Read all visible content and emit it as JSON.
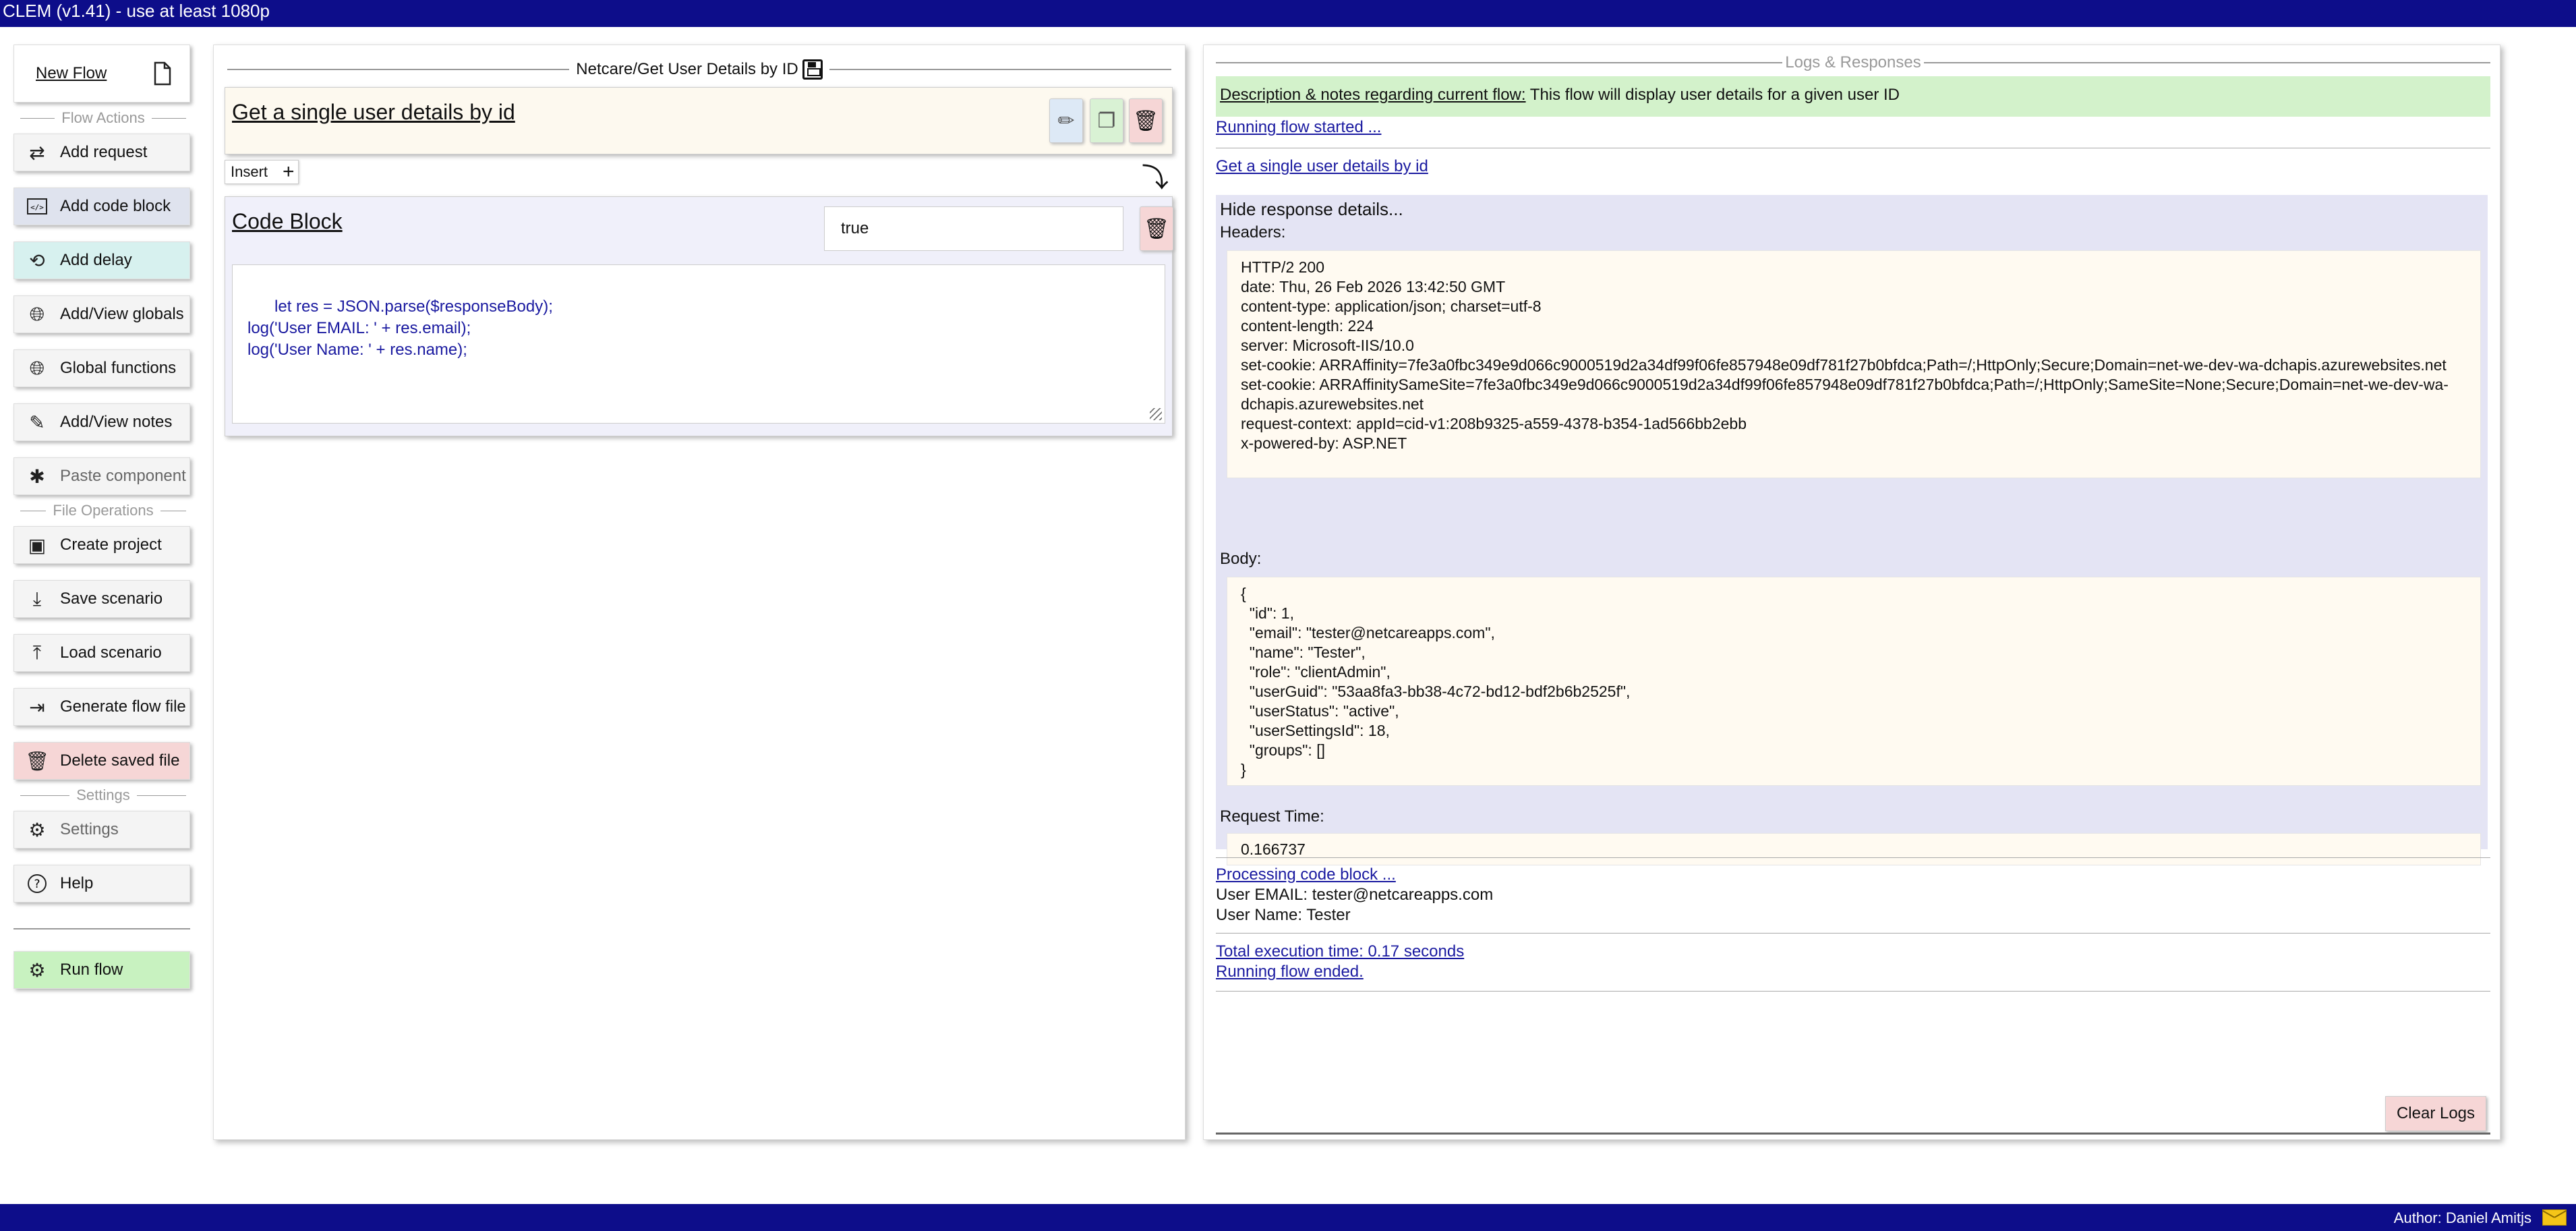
{
  "app": {
    "title": "CLEM (v1.41) - use at least 1080p",
    "author": "Author: Daniel Amitjs"
  },
  "sidebar": {
    "new_flow": "New Flow",
    "sections": {
      "flow_actions": "Flow Actions",
      "file_operations": "File Operations",
      "settings": "Settings"
    },
    "flow_actions": [
      {
        "label": "Add request",
        "icon": "swap-arrows-icon"
      },
      {
        "label": "Add code block",
        "icon": "code-icon"
      },
      {
        "label": "Add delay",
        "icon": "history-icon"
      },
      {
        "label": "Add/View globals",
        "icon": "globe-icon"
      },
      {
        "label": "Global functions",
        "icon": "globe-icon"
      },
      {
        "label": "Add/View notes",
        "icon": "note-icon"
      },
      {
        "label": "Paste component",
        "icon": "puzzle-icon"
      }
    ],
    "file_operations": [
      {
        "label": "Create project",
        "icon": "folder-icon"
      },
      {
        "label": "Save scenario",
        "icon": "download-tray-icon"
      },
      {
        "label": "Load scenario",
        "icon": "upload-tray-icon"
      },
      {
        "label": "Generate flow file",
        "icon": "export-icon"
      },
      {
        "label": "Delete saved file",
        "icon": "trash-icon"
      }
    ],
    "settings_items": [
      {
        "label": "Settings",
        "icon": "sliders-icon"
      },
      {
        "label": "Help",
        "icon": "question-icon"
      }
    ],
    "run_flow": "Run flow"
  },
  "flow": {
    "title": "Netcare/Get User Details by ID",
    "request_name": "Get a single user details by id",
    "insert_label": "Insert",
    "code_block": {
      "name": "Code Block",
      "condition": "true",
      "code": "let res = JSON.parse($responseBody);\nlog('User EMAIL: ' + res.email);\nlog('User Name: ' + res.name);"
    }
  },
  "logs": {
    "title": "Logs & Responses",
    "desc_label": "Description & notes regarding current flow:",
    "desc_text": " This flow will display user details for a given user ID",
    "running_started": "Running flow started ...",
    "request_link": "Get a single user details by id",
    "hide_details": "Hide response details...",
    "headers_label": "Headers:",
    "headers": "HTTP/2 200\ndate: Thu, 26 Feb 2026 13:42:50 GMT\ncontent-type: application/json; charset=utf-8\ncontent-length: 224\nserver: Microsoft-IIS/10.0\nset-cookie: ARRAffinity=7fe3a0fbc349e9d066c9000519d2a34df99f06fe857948e09df781f27b0bfdca;Path=/;HttpOnly;Secure;Domain=net-we-dev-wa-dchapis.azurewebsites.net\nset-cookie: ARRAffinitySameSite=7fe3a0fbc349e9d066c9000519d2a34df99f06fe857948e09df781f27b0bfdca;Path=/;HttpOnly;SameSite=None;Secure;Domain=net-we-dev-wa-\ndchapis.azurewebsites.net\nrequest-context: appId=cid-v1:208b9325-a559-4378-b354-1ad566bb2ebb\nx-powered-by: ASP.NET",
    "body_label": "Body:",
    "body": "{\n  \"id\": 1,\n  \"email\": \"tester@netcareapps.com\",\n  \"name\": \"Tester\",\n  \"role\": \"clientAdmin\",\n  \"userGuid\": \"53aa8fa3-bb38-4c72-bd12-bdf2b6b2525f\",\n  \"userStatus\": \"active\",\n  \"userSettingsId\": 18,\n  \"groups\": []\n}",
    "request_time_label": "Request Time:",
    "request_time": "0.166737",
    "processing": "Processing code block ...",
    "out_email": "User EMAIL: tester@netcareapps.com",
    "out_name": "User Name: Tester",
    "total_time": "Total execution time: 0.17 seconds",
    "ended": "Running flow ended.",
    "clear_logs": "Clear Logs"
  }
}
